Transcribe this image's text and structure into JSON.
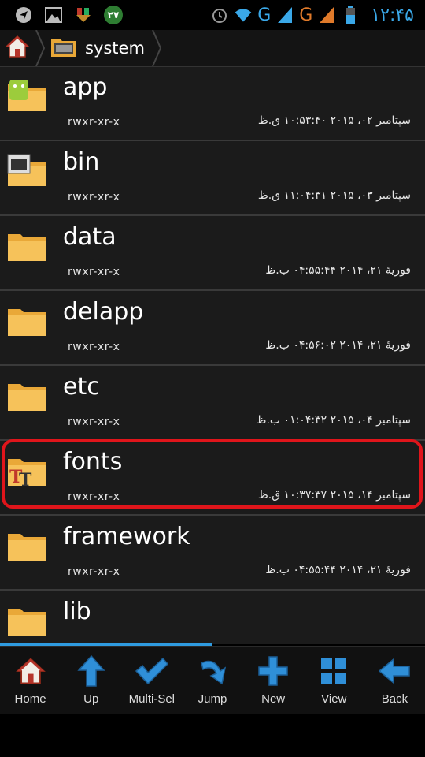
{
  "statusbar": {
    "badge_text": "۲۷",
    "net1": "G",
    "net2": "G",
    "time": "۱۲:۴۵"
  },
  "path": {
    "current_folder": "system"
  },
  "files": [
    {
      "name": "app",
      "perm": "rwxr-xr-x",
      "date": "سپتامبر ۰۲، ۲۰۱۵ ۱۰:۵۳:۴۰ ق.ظ",
      "icon": "android-folder-icon"
    },
    {
      "name": "bin",
      "perm": "rwxr-xr-x",
      "date": "سپتامبر ۰۳، ۲۰۱۵ ۱۱:۰۴:۳۱ ق.ظ",
      "icon": "terminal-folder-icon"
    },
    {
      "name": "data",
      "perm": "rwxr-xr-x",
      "date": "فوریهٔ ۲۱، ۲۰۱۴ ۰۴:۵۵:۴۴ ب.ظ",
      "icon": "folder-icon"
    },
    {
      "name": "delapp",
      "perm": "rwxr-xr-x",
      "date": "فوریهٔ ۲۱، ۲۰۱۴ ۰۴:۵۶:۰۲ ب.ظ",
      "icon": "folder-icon"
    },
    {
      "name": "etc",
      "perm": "rwxr-xr-x",
      "date": "سپتامبر ۰۴، ۲۰۱۵ ۰۱:۰۴:۳۲ ب.ظ",
      "icon": "folder-icon"
    },
    {
      "name": "fonts",
      "perm": "rwxr-xr-x",
      "date": "سپتامبر ۱۴، ۲۰۱۵ ۱۰:۳۷:۳۷ ق.ظ",
      "icon": "fonts-folder-icon"
    },
    {
      "name": "framework",
      "perm": "rwxr-xr-x",
      "date": "فوریهٔ ۲۱، ۲۰۱۴ ۰۴:۵۵:۴۴ ب.ظ",
      "icon": "folder-icon"
    },
    {
      "name": "lib",
      "perm": "",
      "date": "",
      "icon": "folder-icon"
    }
  ],
  "toolbar": {
    "home": "Home",
    "up": "Up",
    "multisel": "Multi-Sel",
    "jump": "Jump",
    "new": "New",
    "view": "View",
    "back": "Back"
  },
  "colors": {
    "accent": "#3aa8e8",
    "highlight": "#e0151b",
    "folder": "#f3b73a"
  }
}
